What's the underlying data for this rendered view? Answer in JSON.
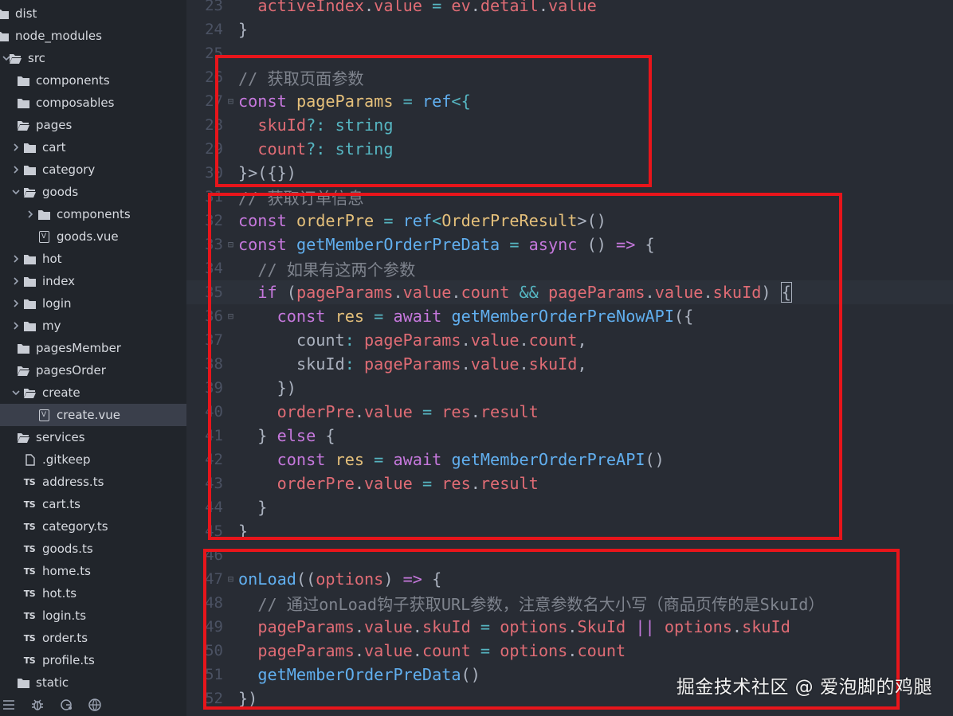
{
  "explorer": {
    "items": [
      {
        "label": "dist",
        "type": "folder",
        "depth": 0,
        "chevron": "none"
      },
      {
        "label": "node_modules",
        "type": "folder",
        "depth": 0,
        "chevron": "none"
      },
      {
        "label": "src",
        "type": "folder-open",
        "depth": 0,
        "chevron": "down"
      },
      {
        "label": "components",
        "type": "folder",
        "depth": 1,
        "chevron": "none"
      },
      {
        "label": "composables",
        "type": "folder",
        "depth": 1,
        "chevron": "none"
      },
      {
        "label": "pages",
        "type": "folder-open",
        "depth": 1,
        "chevron": "none"
      },
      {
        "label": "cart",
        "type": "folder",
        "depth": 2,
        "chevron": "right"
      },
      {
        "label": "category",
        "type": "folder",
        "depth": 2,
        "chevron": "right"
      },
      {
        "label": "goods",
        "type": "folder-open",
        "depth": 2,
        "chevron": "down"
      },
      {
        "label": "components",
        "type": "folder",
        "depth": 3,
        "chevron": "right"
      },
      {
        "label": "goods.vue",
        "type": "vue",
        "depth": 3,
        "chevron": "none"
      },
      {
        "label": "hot",
        "type": "folder",
        "depth": 2,
        "chevron": "right"
      },
      {
        "label": "index",
        "type": "folder",
        "depth": 2,
        "chevron": "right"
      },
      {
        "label": "login",
        "type": "folder",
        "depth": 2,
        "chevron": "right"
      },
      {
        "label": "my",
        "type": "folder",
        "depth": 2,
        "chevron": "right"
      },
      {
        "label": "pagesMember",
        "type": "folder",
        "depth": 1,
        "chevron": "none"
      },
      {
        "label": "pagesOrder",
        "type": "folder-open",
        "depth": 1,
        "chevron": "none"
      },
      {
        "label": "create",
        "type": "folder-open",
        "depth": 2,
        "chevron": "down"
      },
      {
        "label": "create.vue",
        "type": "vue",
        "depth": 3,
        "chevron": "none",
        "selected": true
      },
      {
        "label": "services",
        "type": "folder-open",
        "depth": 1,
        "chevron": "none"
      },
      {
        "label": ".gitkeep",
        "type": "file",
        "depth": 2,
        "chevron": "none"
      },
      {
        "label": "address.ts",
        "type": "ts",
        "depth": 2,
        "chevron": "none"
      },
      {
        "label": "cart.ts",
        "type": "ts",
        "depth": 2,
        "chevron": "none"
      },
      {
        "label": "category.ts",
        "type": "ts",
        "depth": 2,
        "chevron": "none"
      },
      {
        "label": "goods.ts",
        "type": "ts",
        "depth": 2,
        "chevron": "none"
      },
      {
        "label": "home.ts",
        "type": "ts",
        "depth": 2,
        "chevron": "none"
      },
      {
        "label": "hot.ts",
        "type": "ts",
        "depth": 2,
        "chevron": "none"
      },
      {
        "label": "login.ts",
        "type": "ts",
        "depth": 2,
        "chevron": "none"
      },
      {
        "label": "order.ts",
        "type": "ts",
        "depth": 2,
        "chevron": "none"
      },
      {
        "label": "profile.ts",
        "type": "ts",
        "depth": 2,
        "chevron": "none"
      },
      {
        "label": "static",
        "type": "folder",
        "depth": 1,
        "chevron": "none"
      }
    ],
    "ts_badge": "TS",
    "vue_badge": "V",
    "footer_icons": [
      "list-icon",
      "bug-icon",
      "git-icon",
      "extensions-icon"
    ]
  },
  "editor": {
    "lines": [
      {
        "n": "23",
        "fold": "",
        "tokens": [
          {
            "t": "  "
          },
          {
            "t": "activeIndex",
            "c": "v"
          },
          {
            "t": ".",
            "c": "p"
          },
          {
            "t": "value",
            "c": "v"
          },
          {
            "t": " = ",
            "c": "o"
          },
          {
            "t": "ev",
            "c": "v"
          },
          {
            "t": ".",
            "c": "p"
          },
          {
            "t": "detail",
            "c": "v"
          },
          {
            "t": ".",
            "c": "p"
          },
          {
            "t": "value",
            "c": "v"
          }
        ]
      },
      {
        "n": "24",
        "fold": "",
        "tokens": [
          {
            "t": "}",
            "c": "p"
          }
        ]
      },
      {
        "n": "25",
        "fold": "",
        "tokens": []
      },
      {
        "n": "26",
        "fold": "",
        "tokens": [
          {
            "t": "// 获取页面参数",
            "c": "c"
          }
        ]
      },
      {
        "n": "27",
        "fold": "⊟",
        "tokens": [
          {
            "t": "const",
            "c": "k"
          },
          {
            "t": " "
          },
          {
            "t": "pageParams",
            "c": "t"
          },
          {
            "t": " = ",
            "c": "o"
          },
          {
            "t": "ref",
            "c": "f"
          },
          {
            "t": "<{",
            "c": "o"
          }
        ]
      },
      {
        "n": "28",
        "fold": "",
        "tokens": [
          {
            "t": "  "
          },
          {
            "t": "skuId",
            "c": "v"
          },
          {
            "t": "?:",
            "c": "o"
          },
          {
            "t": " "
          },
          {
            "t": "string",
            "c": "o"
          }
        ]
      },
      {
        "n": "29",
        "fold": "",
        "tokens": [
          {
            "t": "  "
          },
          {
            "t": "count",
            "c": "v"
          },
          {
            "t": "?:",
            "c": "o"
          },
          {
            "t": " "
          },
          {
            "t": "string",
            "c": "o"
          }
        ]
      },
      {
        "n": "30",
        "fold": "",
        "tokens": [
          {
            "t": "}>({})",
            "c": "p"
          }
        ]
      },
      {
        "n": "31",
        "fold": "",
        "tokens": [
          {
            "t": "// 获取订单信息",
            "c": "c"
          }
        ]
      },
      {
        "n": "32",
        "fold": "",
        "tokens": [
          {
            "t": "const",
            "c": "k"
          },
          {
            "t": " "
          },
          {
            "t": "orderPre",
            "c": "t"
          },
          {
            "t": " = ",
            "c": "o"
          },
          {
            "t": "ref",
            "c": "f"
          },
          {
            "t": "<",
            "c": "o"
          },
          {
            "t": "OrderPreResult",
            "c": "t"
          },
          {
            "t": ">()",
            "c": "p"
          }
        ]
      },
      {
        "n": "33",
        "fold": "⊟",
        "tokens": [
          {
            "t": "const",
            "c": "k"
          },
          {
            "t": " "
          },
          {
            "t": "getMemberOrderPreData",
            "c": "f"
          },
          {
            "t": " = ",
            "c": "o"
          },
          {
            "t": "async",
            "c": "k"
          },
          {
            "t": " () ",
            "c": "p"
          },
          {
            "t": "=>",
            "c": "k"
          },
          {
            "t": " {",
            "c": "p"
          }
        ]
      },
      {
        "n": "34",
        "fold": "",
        "tokens": [
          {
            "t": "  "
          },
          {
            "t": "// 如果有这两个参数",
            "c": "c"
          }
        ]
      },
      {
        "n": "35",
        "fold": "",
        "active": true,
        "tokens": [
          {
            "t": "  "
          },
          {
            "t": "if",
            "c": "k"
          },
          {
            "t": " (",
            "c": "p"
          },
          {
            "t": "pageParams",
            "c": "v"
          },
          {
            "t": ".",
            "c": "p"
          },
          {
            "t": "value",
            "c": "v"
          },
          {
            "t": ".",
            "c": "p"
          },
          {
            "t": "count",
            "c": "v"
          },
          {
            "t": " && ",
            "c": "o"
          },
          {
            "t": "pageParams",
            "c": "v"
          },
          {
            "t": ".",
            "c": "p"
          },
          {
            "t": "value",
            "c": "v"
          },
          {
            "t": ".",
            "c": "p"
          },
          {
            "t": "skuId",
            "c": "v"
          },
          {
            "t": ") ",
            "c": "p"
          },
          {
            "t": "{",
            "c": "p",
            "cursor": true
          }
        ]
      },
      {
        "n": "36",
        "fold": "⊟",
        "tokens": [
          {
            "t": "    "
          },
          {
            "t": "const",
            "c": "k"
          },
          {
            "t": " "
          },
          {
            "t": "res",
            "c": "t"
          },
          {
            "t": " = ",
            "c": "o"
          },
          {
            "t": "await",
            "c": "k"
          },
          {
            "t": " "
          },
          {
            "t": "getMemberOrderPreNowAPI",
            "c": "f"
          },
          {
            "t": "({",
            "c": "p"
          }
        ]
      },
      {
        "n": "37",
        "fold": "",
        "tokens": [
          {
            "t": "      "
          },
          {
            "t": "count",
            "c": "p"
          },
          {
            "t": ": ",
            "c": "o"
          },
          {
            "t": "pageParams",
            "c": "v"
          },
          {
            "t": ".",
            "c": "p"
          },
          {
            "t": "value",
            "c": "v"
          },
          {
            "t": ".",
            "c": "p"
          },
          {
            "t": "count",
            "c": "v"
          },
          {
            "t": ",",
            "c": "p"
          }
        ]
      },
      {
        "n": "38",
        "fold": "",
        "tokens": [
          {
            "t": "      "
          },
          {
            "t": "skuId",
            "c": "p"
          },
          {
            "t": ": ",
            "c": "o"
          },
          {
            "t": "pageParams",
            "c": "v"
          },
          {
            "t": ".",
            "c": "p"
          },
          {
            "t": "value",
            "c": "v"
          },
          {
            "t": ".",
            "c": "p"
          },
          {
            "t": "skuId",
            "c": "v"
          },
          {
            "t": ",",
            "c": "p"
          }
        ]
      },
      {
        "n": "39",
        "fold": "",
        "tokens": [
          {
            "t": "    })",
            "c": "p"
          }
        ]
      },
      {
        "n": "40",
        "fold": "",
        "tokens": [
          {
            "t": "    "
          },
          {
            "t": "orderPre",
            "c": "v"
          },
          {
            "t": ".",
            "c": "p"
          },
          {
            "t": "value",
            "c": "v"
          },
          {
            "t": " = ",
            "c": "o"
          },
          {
            "t": "res",
            "c": "v"
          },
          {
            "t": ".",
            "c": "p"
          },
          {
            "t": "result",
            "c": "v"
          }
        ]
      },
      {
        "n": "41",
        "fold": "",
        "tokens": [
          {
            "t": "  } ",
            "c": "p"
          },
          {
            "t": "else",
            "c": "k"
          },
          {
            "t": " {",
            "c": "p"
          }
        ]
      },
      {
        "n": "42",
        "fold": "",
        "tokens": [
          {
            "t": "    "
          },
          {
            "t": "const",
            "c": "k"
          },
          {
            "t": " "
          },
          {
            "t": "res",
            "c": "t"
          },
          {
            "t": " = ",
            "c": "o"
          },
          {
            "t": "await",
            "c": "k"
          },
          {
            "t": " "
          },
          {
            "t": "getMemberOrderPreAPI",
            "c": "f"
          },
          {
            "t": "()",
            "c": "p"
          }
        ]
      },
      {
        "n": "43",
        "fold": "",
        "tokens": [
          {
            "t": "    "
          },
          {
            "t": "orderPre",
            "c": "v"
          },
          {
            "t": ".",
            "c": "p"
          },
          {
            "t": "value",
            "c": "v"
          },
          {
            "t": " = ",
            "c": "o"
          },
          {
            "t": "res",
            "c": "v"
          },
          {
            "t": ".",
            "c": "p"
          },
          {
            "t": "result",
            "c": "v"
          }
        ]
      },
      {
        "n": "44",
        "fold": "",
        "tokens": [
          {
            "t": "  }",
            "c": "p"
          }
        ]
      },
      {
        "n": "45",
        "fold": "",
        "tokens": [
          {
            "t": "}",
            "c": "p"
          }
        ]
      },
      {
        "n": "46",
        "fold": "",
        "tokens": []
      },
      {
        "n": "47",
        "fold": "⊟",
        "tokens": [
          {
            "t": "onLoad",
            "c": "f"
          },
          {
            "t": "((",
            "c": "p"
          },
          {
            "t": "options",
            "c": "v"
          },
          {
            "t": ") ",
            "c": "p"
          },
          {
            "t": "=>",
            "c": "k"
          },
          {
            "t": " {",
            "c": "p"
          }
        ]
      },
      {
        "n": "48",
        "fold": "",
        "tokens": [
          {
            "t": "  "
          },
          {
            "t": "// 通过onLoad钩子获取URL参数，注意参数名大小写（商品页传的是SkuId）",
            "c": "c"
          }
        ]
      },
      {
        "n": "49",
        "fold": "",
        "tokens": [
          {
            "t": "  "
          },
          {
            "t": "pageParams",
            "c": "v"
          },
          {
            "t": ".",
            "c": "p"
          },
          {
            "t": "value",
            "c": "v"
          },
          {
            "t": ".",
            "c": "p"
          },
          {
            "t": "skuId",
            "c": "v"
          },
          {
            "t": " = ",
            "c": "o"
          },
          {
            "t": "options",
            "c": "v"
          },
          {
            "t": ".",
            "c": "p"
          },
          {
            "t": "SkuId",
            "c": "v"
          },
          {
            "t": " || ",
            "c": "k"
          },
          {
            "t": "options",
            "c": "v"
          },
          {
            "t": ".",
            "c": "p"
          },
          {
            "t": "skuId",
            "c": "v"
          }
        ]
      },
      {
        "n": "50",
        "fold": "",
        "tokens": [
          {
            "t": "  "
          },
          {
            "t": "pageParams",
            "c": "v"
          },
          {
            "t": ".",
            "c": "p"
          },
          {
            "t": "value",
            "c": "v"
          },
          {
            "t": ".",
            "c": "p"
          },
          {
            "t": "count",
            "c": "v"
          },
          {
            "t": " = ",
            "c": "o"
          },
          {
            "t": "options",
            "c": "v"
          },
          {
            "t": ".",
            "c": "p"
          },
          {
            "t": "count",
            "c": "v"
          }
        ]
      },
      {
        "n": "51",
        "fold": "",
        "tokens": [
          {
            "t": "  "
          },
          {
            "t": "getMemberOrderPreData",
            "c": "f"
          },
          {
            "t": "()",
            "c": "p"
          }
        ]
      },
      {
        "n": "52",
        "fold": "",
        "tokens": [
          {
            "t": "})",
            "c": "p"
          }
        ]
      }
    ]
  },
  "watermark": "掘金技术社区 @ 爱泡脚的鸡腿",
  "colors": {
    "highlight_box": "#e8151b",
    "background": "#282c34",
    "sidebar": "#21252b"
  }
}
